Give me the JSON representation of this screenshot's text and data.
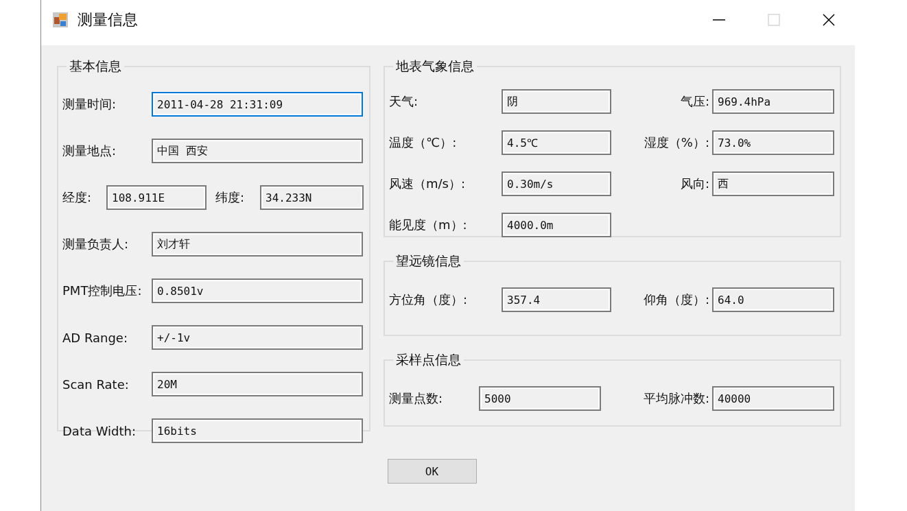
{
  "window": {
    "title": "测量信息"
  },
  "basic_info": {
    "title": "基本信息",
    "rows": [
      [
        {
          "label": "测量时间:",
          "value": "2011-04-28 21:31:09",
          "focused": true
        }
      ],
      [
        {
          "label": "测量地点:",
          "value": "中国 西安",
          "focused": false
        }
      ],
      [
        {
          "label": "经度:",
          "value": "108.911E",
          "focused": false
        },
        {
          "label": "纬度:",
          "value": "34.233N",
          "focused": false
        }
      ],
      [
        {
          "label": "测量负责人:",
          "value": "刘才轩",
          "focused": false
        }
      ],
      [
        {
          "label": "PMT控制电压:",
          "value": "0.8501v",
          "focused": false
        }
      ],
      [
        {
          "label": "AD Range:",
          "value": "+/-1v",
          "focused": false
        }
      ],
      [
        {
          "label": "Scan Rate:",
          "value": "20M",
          "focused": false
        }
      ],
      [
        {
          "label": "Data Width:",
          "value": "16bits",
          "focused": false
        }
      ]
    ]
  },
  "weather_info": {
    "title": "地表气象信息",
    "rows": [
      [
        {
          "label": "天气:",
          "value": "阴",
          "focused": false
        },
        {
          "label": "气压:",
          "value": "969.4hPa",
          "focused": false
        }
      ],
      [
        {
          "label": "温度（℃）:",
          "value": "4.5℃",
          "focused": false
        },
        {
          "label": "湿度（%）:",
          "value": "73.0%",
          "focused": false
        }
      ],
      [
        {
          "label": "风速（m/s）:",
          "value": "0.30m/s",
          "focused": false
        },
        {
          "label": "风向:",
          "value": "西",
          "focused": false
        }
      ],
      [
        {
          "label": "能见度（m）:",
          "value": "4000.0m",
          "focused": false
        }
      ]
    ]
  },
  "telescope_info": {
    "title": "望远镜信息",
    "rows": [
      [
        {
          "label": "方位角（度）:",
          "value": "357.4",
          "focused": false
        },
        {
          "label": "仰角（度）:",
          "value": "64.0",
          "focused": false
        }
      ]
    ]
  },
  "sampling_info": {
    "title": "采样点信息",
    "rows": [
      [
        {
          "label": "测量点数:",
          "value": "5000",
          "focused": false
        },
        {
          "label": "平均脉冲数:",
          "value": "40000",
          "focused": false
        }
      ]
    ]
  },
  "buttons": [
    "OK"
  ]
}
